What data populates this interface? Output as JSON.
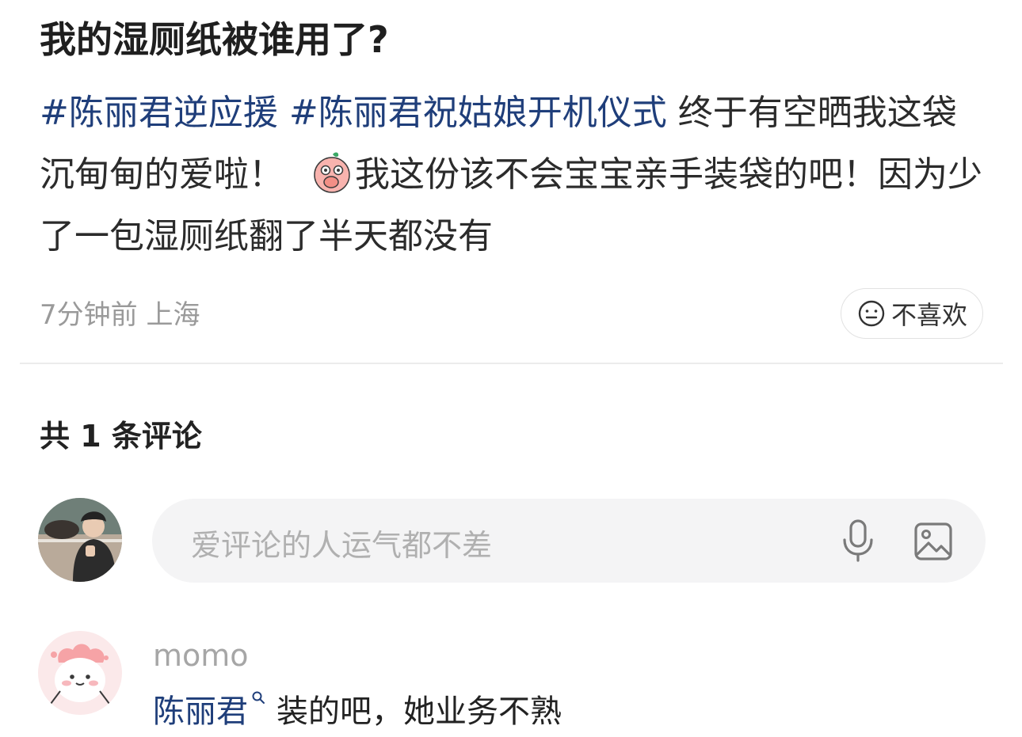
{
  "post": {
    "title": "我的湿厕纸被谁用了?",
    "tag1": "#陈丽君逆应援",
    "tag2": "#陈丽君祝姑娘开机仪式",
    "text_part1": " 终于有空晒我这袋沉甸甸的爱啦！",
    "emoji": "blush-hand-over-mouth-emoji",
    "text_part2": "我这份该不会宝宝亲手装袋的吧！因为少了一包湿厕纸翻了半天都没有",
    "time": "7分钟前",
    "location": "上海",
    "dislike_label": "不喜欢"
  },
  "comments": {
    "count_label": "共 1 条评论",
    "input_placeholder": "爱评论的人运气都不差",
    "items": [
      {
        "username": "momo",
        "mention": "陈丽君",
        "text": "装的吧，她业务不熟"
      }
    ]
  },
  "colors": {
    "hashtag": "#1f3e7a",
    "muted": "#9a9a9a",
    "input_bg": "#f4f4f5"
  },
  "icons": [
    "neutral-face-icon",
    "microphone-icon",
    "image-icon",
    "search-icon"
  ]
}
